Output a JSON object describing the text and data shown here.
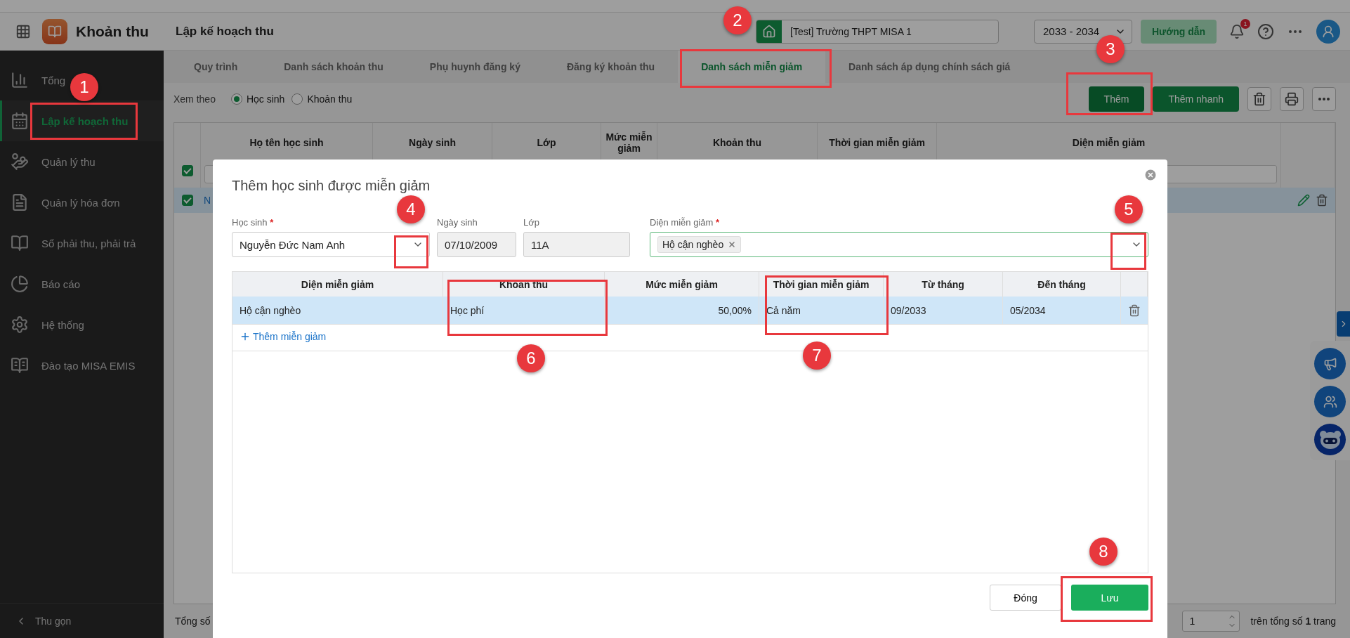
{
  "app": {
    "name": "Khoản thu",
    "page_title": "Lập kế hoạch thu"
  },
  "header": {
    "school": "[Test] Trường THPT MISA 1",
    "year": "2033 - 2034",
    "guide_button": "Hướng dẫn",
    "notification_count": "1"
  },
  "sidebar": {
    "items": [
      {
        "label": "Tổng",
        "selected": false
      },
      {
        "label": "Lập kế hoạch thu",
        "selected": true
      },
      {
        "label": "Quản lý thu",
        "selected": false
      },
      {
        "label": "Quản lý hóa đơn",
        "selected": false
      },
      {
        "label": "Sổ phải thu, phải trả",
        "selected": false
      },
      {
        "label": "Báo cáo",
        "selected": false
      },
      {
        "label": "Hệ thống",
        "selected": false
      },
      {
        "label": "Đào tạo MISA EMIS",
        "selected": false
      }
    ],
    "collapse": "Thu gọn"
  },
  "tabs": [
    {
      "label": "Quy trình",
      "selected": false
    },
    {
      "label": "Danh sách khoản thu",
      "selected": false
    },
    {
      "label": "Phụ huynh đăng ký",
      "selected": false
    },
    {
      "label": "Đăng ký khoản thu",
      "selected": false
    },
    {
      "label": "Danh sách miễn giảm",
      "selected": true
    },
    {
      "label": "Danh sách áp dụng chính sách giá",
      "selected": false
    }
  ],
  "view_by": {
    "label": "Xem theo",
    "options": [
      {
        "label": "Học sinh",
        "selected": true
      },
      {
        "label": "Khoản thu",
        "selected": false
      }
    ]
  },
  "toolbar": {
    "add": "Thêm",
    "quick_add": "Thêm nhanh"
  },
  "table": {
    "all_checked": true,
    "columns": [
      "Họ tên học sinh",
      "Ngày sinh",
      "Lớp",
      "Mức miễn giảm",
      "Khoản thu",
      "Thời gian miễn giảm",
      "Diện miễn giảm"
    ],
    "rows": [
      {
        "checked": true,
        "selected": true,
        "student": "N"
      }
    ]
  },
  "footer": {
    "total_label": "Tổng số",
    "page": "1",
    "pages_text": "trên tổng số **1** trang"
  },
  "modal": {
    "title": "Thêm học sinh được miễn giảm",
    "fields": [
      {
        "kind": "select",
        "label": "Học sinh",
        "required_mark": "*",
        "value": "Nguyễn Đức Nam Anh"
      },
      {
        "kind": "readonly",
        "label": "Ngày sinh",
        "value": "07/10/2009"
      },
      {
        "kind": "readonly",
        "label": "Lớp",
        "value": "11A"
      },
      {
        "kind": "tags",
        "label": "Diện miễn giảm",
        "required_mark": "*",
        "tags": [
          "Hộ cận nghèo"
        ]
      }
    ],
    "columns": [
      "Diện miễn giảm",
      "Khoản thu",
      "Mức miễn giảm",
      "Thời gian miễn giảm",
      "Từ tháng",
      "Đến tháng"
    ],
    "rows": [
      {
        "selected": true,
        "cells": [
          "Hộ cận nghèo",
          "Học phí",
          "50,00%",
          "Cả năm",
          "09/2033",
          "05/2034"
        ]
      }
    ],
    "add_link": "Thêm miễn giảm",
    "close_button": "Đóng",
    "save_button": "Lưu"
  },
  "annotations": [
    {
      "number": "1"
    },
    {
      "number": "2"
    },
    {
      "number": "3"
    },
    {
      "number": "4"
    },
    {
      "number": "5"
    },
    {
      "number": "6"
    },
    {
      "number": "7"
    },
    {
      "number": "8"
    }
  ]
}
